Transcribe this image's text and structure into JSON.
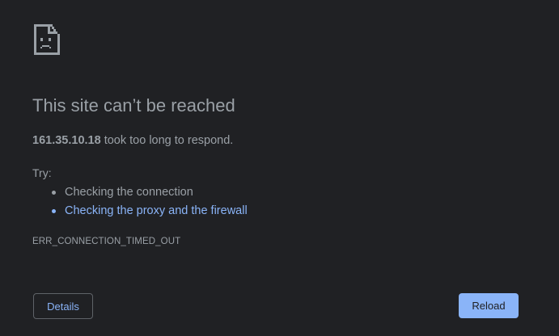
{
  "error_page": {
    "icon": "sad-page-icon",
    "title": "This site can’t be reached",
    "host": "161.35.10.18",
    "description_suffix": " took too long to respond.",
    "try_label": "Try:",
    "suggestions": [
      {
        "label": "Checking the connection",
        "is_link": false
      },
      {
        "label": "Checking the proxy and the firewall",
        "is_link": true
      }
    ],
    "error_code": "ERR_CONNECTION_TIMED_OUT"
  },
  "buttons": {
    "details_label": "Details",
    "reload_label": "Reload"
  },
  "colors": {
    "background": "#202124",
    "text": "#9aa0a6",
    "link": "#8ab4f8",
    "button_border": "#5f6368"
  }
}
